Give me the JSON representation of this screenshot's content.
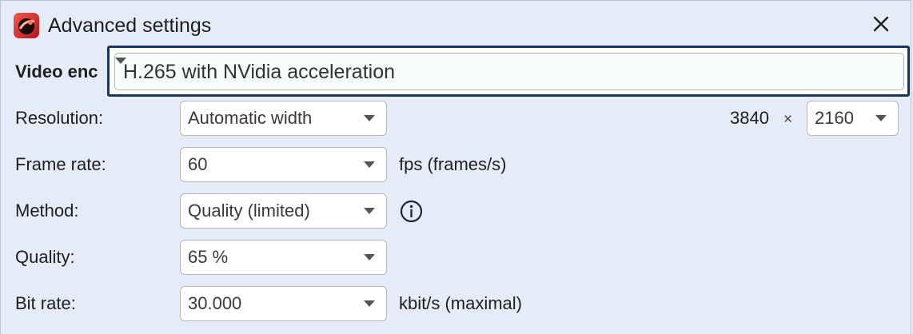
{
  "window": {
    "title": "Advanced settings",
    "icons": {
      "app": "app-logo-icon",
      "close": "close-icon"
    }
  },
  "video_encoder": {
    "label": "Video enc",
    "value": "H.265 with NVidia acceleration"
  },
  "resolution": {
    "label": "Resolution:",
    "mode": "Automatic width",
    "width": "3840",
    "times": "×",
    "height": "2160"
  },
  "frame_rate": {
    "label": "Frame rate:",
    "value": "60",
    "unit": "fps (frames/s)"
  },
  "method": {
    "label": "Method:",
    "value": "Quality (limited)",
    "info_icon": "info-icon"
  },
  "quality": {
    "label": "Quality:",
    "value": "65 %"
  },
  "bit_rate": {
    "label": "Bit rate:",
    "value": "30.000",
    "unit": "kbit/s (maximal)"
  },
  "colors": {
    "background": "#e6ecf7",
    "focus_border": "#17375a",
    "app_icon": "#d42b2b"
  }
}
